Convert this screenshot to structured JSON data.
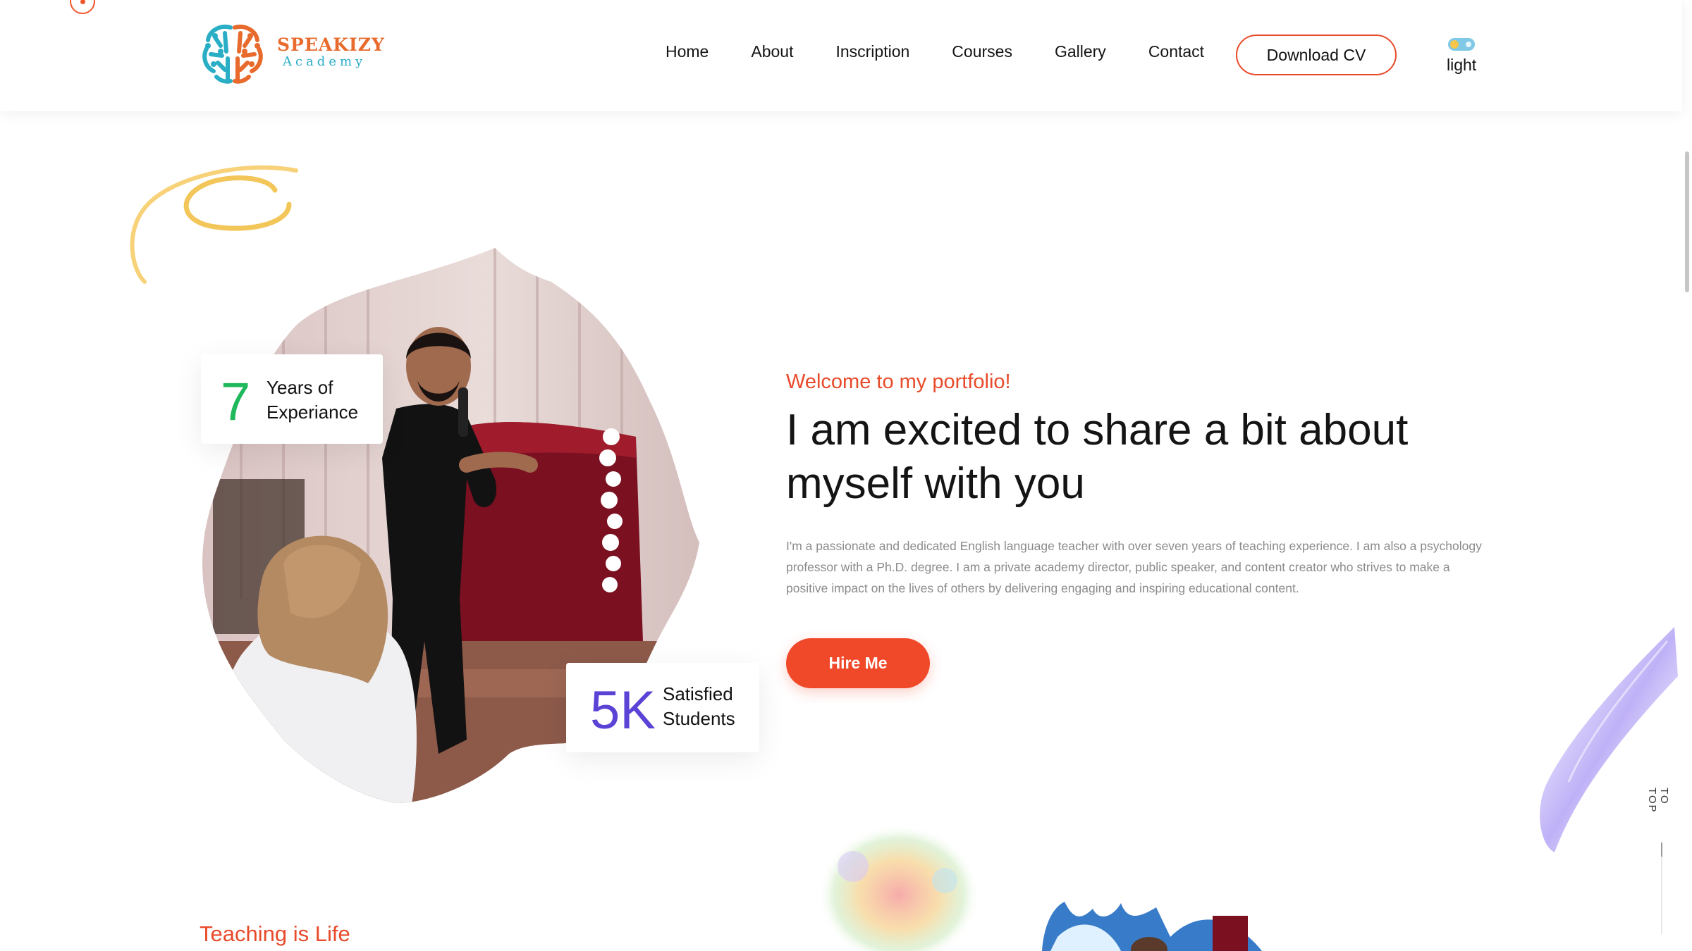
{
  "brand": {
    "name": "SPEAKIZY",
    "sub": "Academy"
  },
  "nav": {
    "items": [
      "Home",
      "About",
      "Inscription",
      "Courses",
      "Gallery",
      "Contact"
    ]
  },
  "header": {
    "cv_button": "Download CV",
    "theme_label": "light"
  },
  "stats": {
    "experience": {
      "number": "7",
      "label": "Years of Experiance"
    },
    "students": {
      "number": "5K",
      "label": "Satisfied Students"
    }
  },
  "hero": {
    "welcome": "Welcome to my portfolio!",
    "headline": "I am excited to share a bit about myself with you",
    "description": "I'm a passionate and dedicated English language teacher with over seven years of teaching experience. I am also a psychology professor with a Ph.D. degree. I am a private academy director, public speaker, and content creator who strives to make a positive impact on the lives of others by delivering engaging and inspiring educational content.",
    "hire_button": "Hire Me"
  },
  "next_section": {
    "kicker": "Teaching is Life"
  },
  "to_top": "TO TOP",
  "colors": {
    "accent": "#f0492a",
    "green": "#1fb85a",
    "purple": "#5b43d6",
    "logo_orange": "#e86a2c",
    "logo_teal": "#29aec5"
  },
  "icons": [
    "brain-logo-icon",
    "theme-toggle-icon",
    "cursor-dot-icon"
  ]
}
